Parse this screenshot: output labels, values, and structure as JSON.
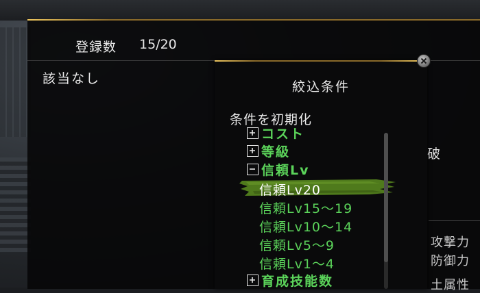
{
  "main": {
    "registered_label": "登録数",
    "registered_value": "15/20",
    "no_match": "該当なし",
    "partial_char": "破",
    "stats": [
      "攻撃力",
      "防御力",
      "土属性"
    ]
  },
  "filter": {
    "title": "絞込条件",
    "reset": "条件を初期化",
    "categories": [
      {
        "label": "コスト",
        "expanded": false
      },
      {
        "label": "等級",
        "expanded": false
      },
      {
        "label": "信頼Lv",
        "expanded": true
      },
      {
        "label": "育成技能数",
        "expanded": false
      }
    ],
    "trust_options": [
      "信頼Lv20",
      "信頼Lv15～19",
      "信頼Lv10～14",
      "信頼Lv5～9",
      "信頼Lv1～4"
    ],
    "selected_option": "信頼Lv20",
    "scroll_fraction_visible": 0.83
  },
  "colors": {
    "accent_green": "#5bd35a",
    "selection_brush": "#4f7a1c",
    "gold_border": "#8a6a2a"
  },
  "icons": {
    "close": "close-icon",
    "collapsed": "plus-box-icon",
    "expanded": "minus-box-icon"
  }
}
